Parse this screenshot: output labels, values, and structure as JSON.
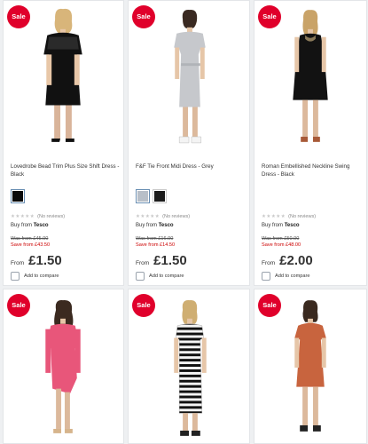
{
  "products": [
    {
      "sale_badge": "Sale",
      "title": "Lovedrobe Bead Trim Plus Size Shift Dress - Black",
      "swatches": [
        "#0a0a0a"
      ],
      "rating_text": "(No reviews)",
      "buy_prefix": "Buy from",
      "buy_store": "Tesco",
      "was": "Was from £45.00",
      "save": "Save from £43.50",
      "from_label": "From",
      "price": "£1.50",
      "compare_label": "Add to compare"
    },
    {
      "sale_badge": "Sale",
      "title": "F&F Tie Front Midi Dress - Grey",
      "swatches": [
        "#b8bfc8",
        "#1c1c1c"
      ],
      "rating_text": "(No reviews)",
      "buy_prefix": "Buy from",
      "buy_store": "Tesco",
      "was": "Was from £16.00",
      "save": "Save from £14.50",
      "from_label": "From",
      "price": "£1.50",
      "compare_label": "Add to compare"
    },
    {
      "sale_badge": "Sale",
      "title": "Roman Embellished Neckline Swing Dress - Black",
      "swatches": [],
      "rating_text": "(No reviews)",
      "buy_prefix": "Buy from",
      "buy_store": "Tesco",
      "was": "Was from £50.00",
      "save": "Save from £48.00",
      "from_label": "From",
      "price": "£2.00",
      "compare_label": "Add to compare"
    },
    {
      "sale_badge": "Sale"
    },
    {
      "sale_badge": "Sale"
    },
    {
      "sale_badge": "Sale"
    }
  ],
  "colors": {
    "sale_badge": "#e0002b",
    "save_text": "#cc0000"
  }
}
